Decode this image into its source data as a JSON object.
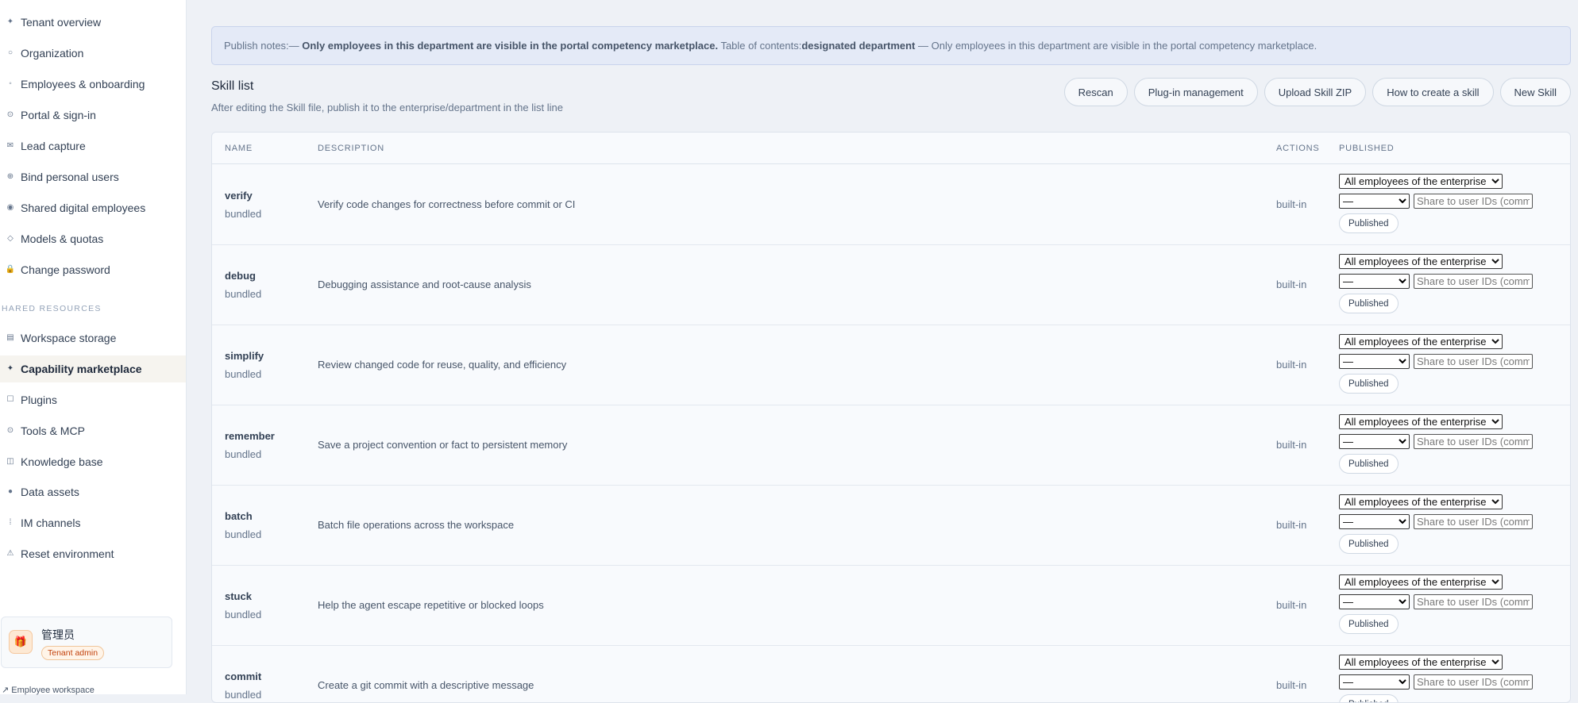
{
  "sidebar": {
    "items": [
      {
        "label": "Tenant overview",
        "icon": "✦"
      },
      {
        "label": "Organization",
        "icon": "○"
      },
      {
        "label": "Employees & onboarding",
        "icon": "◦"
      },
      {
        "label": "Portal & sign-in",
        "icon": "⊙"
      },
      {
        "label": "Lead capture",
        "icon": "✉"
      },
      {
        "label": "Bind personal users",
        "icon": "⊕"
      },
      {
        "label": "Shared digital employees",
        "icon": "◉"
      },
      {
        "label": "Models & quotas",
        "icon": "◇"
      },
      {
        "label": "Change password",
        "icon": "🔒"
      }
    ],
    "section_label": "HARED RESOURCES",
    "resource_items": [
      {
        "label": "Workspace storage",
        "icon": "▤"
      },
      {
        "label": "Capability marketplace",
        "icon": "✦"
      },
      {
        "label": "Plugins",
        "icon": "☐"
      },
      {
        "label": "Tools & MCP",
        "icon": "⊙"
      },
      {
        "label": "Knowledge base",
        "icon": "◫"
      },
      {
        "label": "Data assets",
        "icon": "●"
      },
      {
        "label": "IM channels",
        "icon": "⁞"
      },
      {
        "label": "Reset environment",
        "icon": "⚠"
      }
    ],
    "user": {
      "name": "管理员",
      "badge": "Tenant admin",
      "avatar_icon": "🎁"
    },
    "employee_link": "↗ Employee workspace"
  },
  "notice": {
    "prefix": "Publish notes:— ",
    "bold1": "Only employees in this department are visible in the portal competency marketplace.",
    "middle": " Table of contents:",
    "bold2": "designated department",
    "suffix": " — Only employees in this department are visible in the portal competency marketplace."
  },
  "page": {
    "title": "Skill list",
    "subtitle": "After editing the Skill file, publish it to the enterprise/department in the list line"
  },
  "toolbar": {
    "rescan": "Rescan",
    "plugin_mgmt": "Plug-in management",
    "upload_zip": "Upload Skill ZIP",
    "how_to": "How to create a skill",
    "new_skill": "New Skill"
  },
  "table": {
    "headers": {
      "name": "NAME",
      "description": "DESCRIPTION",
      "actions": "ACTIONS",
      "published": "PUBLISHED"
    },
    "scope_option": "All employees of the enterprise",
    "dept_option": "—",
    "share_placeholder": "Share to user IDs (comma-separated)",
    "publish_label": "Published",
    "rows": [
      {
        "name": "verify",
        "source": "bundled",
        "description": "Verify code changes for correctness before commit or CI",
        "action": "built-in"
      },
      {
        "name": "debug",
        "source": "bundled",
        "description": "Debugging assistance and root-cause analysis",
        "action": "built-in"
      },
      {
        "name": "simplify",
        "source": "bundled",
        "description": "Review changed code for reuse, quality, and efficiency",
        "action": "built-in"
      },
      {
        "name": "remember",
        "source": "bundled",
        "description": "Save a project convention or fact to persistent memory",
        "action": "built-in"
      },
      {
        "name": "batch",
        "source": "bundled",
        "description": "Batch file operations across the workspace",
        "action": "built-in"
      },
      {
        "name": "stuck",
        "source": "bundled",
        "description": "Help the agent escape repetitive or blocked loops",
        "action": "built-in"
      },
      {
        "name": "commit",
        "source": "bundled",
        "description": "Create a git commit with a descriptive message",
        "action": "built-in"
      }
    ]
  }
}
